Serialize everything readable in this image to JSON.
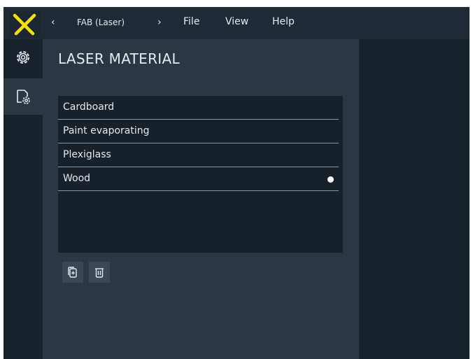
{
  "colors": {
    "accent": "#f5e10a",
    "panel": "#2b3843",
    "list_bg": "#17212a",
    "toolbar": "#18222c",
    "selected_dot": "#ffffff"
  },
  "topbar": {
    "breadcrumb": "FAB (Laser)",
    "prev_icon": "chevron-left-icon",
    "next_icon": "chevron-right-icon",
    "menu": [
      "File",
      "View",
      "Help"
    ]
  },
  "toolbar": {
    "items": [
      {
        "name": "settings",
        "icon": "gear-icon"
      },
      {
        "name": "material-settings",
        "icon": "document-gear-icon",
        "active": true
      }
    ]
  },
  "panel": {
    "title": "LASER MATERIAL",
    "materials": [
      {
        "label": "Cardboard",
        "selected": false
      },
      {
        "label": "Paint evaporating",
        "selected": false
      },
      {
        "label": "Plexiglass",
        "selected": false
      },
      {
        "label": "Wood",
        "selected": true
      }
    ],
    "actions": [
      {
        "name": "duplicate",
        "icon": "duplicate-icon"
      },
      {
        "name": "delete",
        "icon": "trash-icon"
      }
    ]
  }
}
